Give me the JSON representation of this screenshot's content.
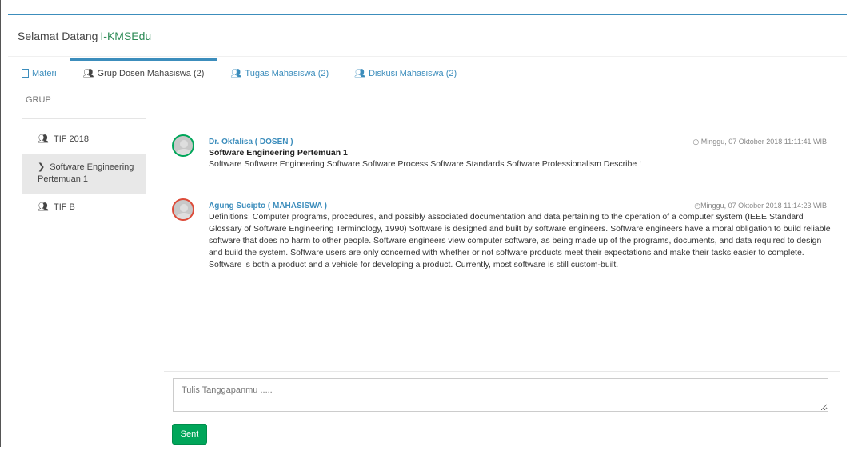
{
  "header": {
    "greeting": "Selamat Datang",
    "brand": "I-KMSEdu"
  },
  "tabs": [
    {
      "label": "Materi",
      "icon": "file-icon",
      "active": false
    },
    {
      "label": "Grup Dosen Mahasiswa (2)",
      "icon": "users-icon",
      "active": true
    },
    {
      "label": "Tugas Mahasiswa (2)",
      "icon": "users-icon",
      "active": false
    },
    {
      "label": "Diskusi Mahasiswa (2)",
      "icon": "users-icon",
      "active": false
    }
  ],
  "sidebar": {
    "title": "GRUP",
    "items": [
      {
        "label": "TIF 2018",
        "icon": "users-icon",
        "active": false
      },
      {
        "label": "Software Engineering Pertemuan 1",
        "icon": "chevron-right-icon",
        "active": true
      },
      {
        "label": "TIF B",
        "icon": "users-icon",
        "active": false
      }
    ]
  },
  "posts": [
    {
      "author": "Dr. Okfalisa ( DOSEN )",
      "time": "Minggu, 07 Oktober 2018 11:11:41 WIB",
      "subject": "Software Engineering Pertemuan 1",
      "message": "Software Software Engineering Software Software Process Software Standards Software Professionalism Describe !",
      "avatar_border": "#00a65a"
    },
    {
      "author": "Agung Sucipto ( MAHASISWA )",
      "time": "Minggu, 07 Oktober 2018 11:14:23 WIB",
      "subject": "",
      "message": "Definitions: Computer programs, procedures, and possibly associated documentation and data pertaining to the operation of a computer system (IEEE Standard Glossary of Software Engineering Terminology, 1990) Software is designed and built by software engineers. Software engineers have a moral obligation to build reliable software that does no harm to other people. Software engineers view computer software, as being made up of the programs, documents, and data required to design and build the system. Software users are only concerned with whether or not software products meet their expectations and make their tasks easier to complete. Software is both a product and a vehicle for developing a product. Currently, most software is still custom-built.",
      "avatar_border": "#dd4b39"
    }
  ],
  "reply": {
    "placeholder": "Tulis Tanggapanmu .....",
    "send_label": "Sent"
  },
  "colors": {
    "accent": "#3c8dbc",
    "brand": "#2e8b57",
    "send_button": "#00a65a"
  }
}
